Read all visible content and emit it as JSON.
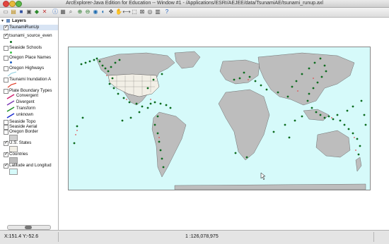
{
  "window": {
    "title": "ArcExplorer-Java Edition for Education -- Window #1 - /Applications/ESRI/AEJEE/data/TsunamiAE/tsunami_runup.axl"
  },
  "toolbar": {
    "icons": [
      "new-project-icon",
      "open-icon",
      "save-icon",
      "print-icon",
      "add-layer-icon",
      "remove-layer-icon",
      "identify-icon",
      "query-icon",
      "find-icon",
      "zoom-in-icon",
      "zoom-out-icon",
      "full-extent-icon",
      "previous-extent-icon",
      "pan-icon",
      "pan-tool-icon",
      "measure-icon",
      "select-icon",
      "clear-selection-icon",
      "buffer-icon",
      "table-icon",
      "help-icon"
    ]
  },
  "layers": {
    "heading": "Layers",
    "items": [
      {
        "label": "TsunamiRunUp",
        "checked": true,
        "selected": true
      },
      {
        "label": "tsunami_source_even",
        "checked": true
      },
      {
        "label": "Seaside Schools",
        "checked": false
      },
      {
        "label": "Oregon Place Names",
        "checked": false
      },
      {
        "label": "Oregon Highways",
        "checked": false
      },
      {
        "label": "Tsunami Inundation A",
        "checked": false
      },
      {
        "label": "Plate Boundary Types",
        "checked": false
      },
      {
        "label": "Seaside Topo",
        "checked": false
      },
      {
        "label": "Seaside Aerial",
        "checked": false
      },
      {
        "label": "Oregon Border",
        "checked": false
      },
      {
        "label": "U.S. States",
        "checked": true
      },
      {
        "label": "Countries",
        "checked": true
      },
      {
        "label": "Latitude and Longitud",
        "checked": true
      }
    ],
    "plate_legend": [
      "Convergent",
      "Divergent",
      "Transform",
      "unknown"
    ]
  },
  "colors": {
    "ocean": "#d6fafa",
    "land": "#bdbdbd",
    "us_states": "#f2efe6",
    "tsunami_points": "#0b6b1e",
    "source_points": "#e05050",
    "convergent": "#d0206e",
    "divergent": "#7d3bb5",
    "transform": "#1f8f2a",
    "unknown": "#1a2bd0"
  },
  "status": {
    "coordinates": "X:151.4 Y:-52.6",
    "scale": "1 :126,078,975"
  }
}
